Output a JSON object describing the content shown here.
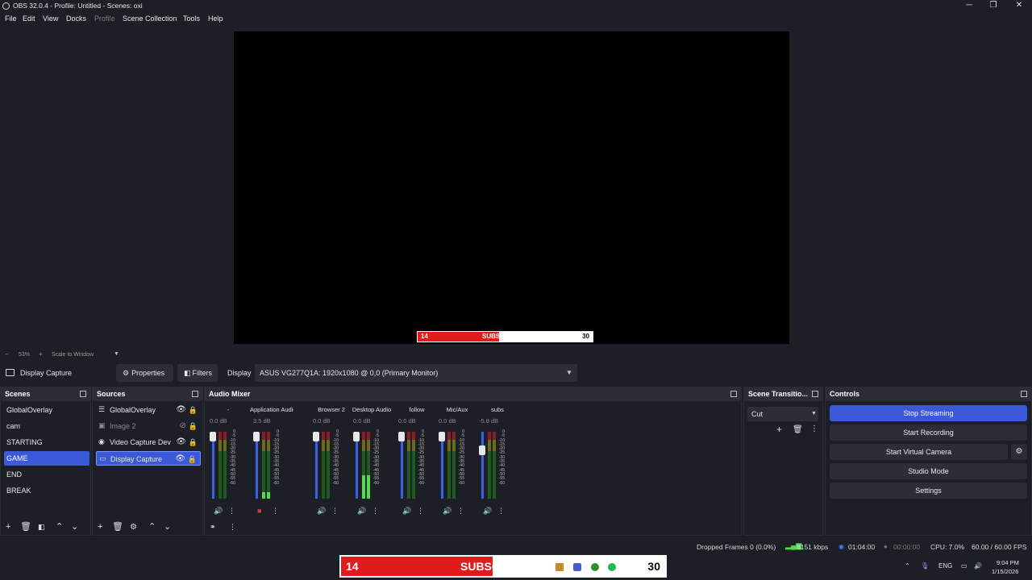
{
  "window": {
    "title": "OBS 32.0.4 - Profile: Untitled - Scenes: oxi",
    "controls": {
      "minimize": "─",
      "maximize": "❐",
      "close": "✕"
    }
  },
  "menu": [
    "File",
    "Edit",
    "View",
    "Docks",
    "Profile",
    "Scene Collection",
    "Tools",
    "Help"
  ],
  "preview": {
    "overlay": {
      "left_number": "14",
      "label": "SUBSCRIBERS",
      "right_number": "30",
      "progress": 0.467
    },
    "zoom_minus": "−",
    "zoom_value": "53%",
    "zoom_plus": "+",
    "scale_mode": "Scale to Window"
  },
  "source_toolbar": {
    "source_name": "Display Capture",
    "properties_label": "Properties",
    "filters_label": "Filters",
    "display_label": "Display",
    "display_value": "ASUS VG277Q1A: 1920x1080 @ 0,0 (Primary Monitor)"
  },
  "scenes": {
    "title": "Scenes",
    "items": [
      "GlobalOverlay",
      "cam",
      "STARTING",
      "GAME",
      "END",
      "BREAK"
    ],
    "active": "GAME"
  },
  "sources": {
    "title": "Sources",
    "items": [
      {
        "name": "GlobalOverlay",
        "icon": "list-icon",
        "visible": true
      },
      {
        "name": "Image 2",
        "icon": "image-icon",
        "visible": false
      },
      {
        "name": "Video Capture Dev",
        "icon": "camera-icon",
        "visible": true
      },
      {
        "name": "Display Capture",
        "icon": "monitor-icon",
        "visible": true
      }
    ],
    "active": "Display Capture"
  },
  "audio_mixer": {
    "title": "Audio Mixer",
    "scale": [
      "0",
      "-5",
      "-10",
      "-15",
      "-20",
      "-25",
      "-30",
      "-35",
      "-40",
      "-45",
      "-50",
      "-55",
      "-60"
    ],
    "channels": [
      {
        "name": "-",
        "db": "0.0 dB",
        "level": 0.0,
        "fader": 1.0,
        "muted": false
      },
      {
        "name": "Application Audio C",
        "db": "3.5 dB",
        "level": 0.1,
        "fader": 1.0,
        "muted": true
      },
      {
        "name": "Browser 2",
        "db": "0.0 dB",
        "level": 0.0,
        "fader": 1.0,
        "muted": false
      },
      {
        "name": "Desktop Audio",
        "db": "0.0 dB",
        "level": 0.35,
        "fader": 1.0,
        "muted": false
      },
      {
        "name": "follow",
        "db": "0.0 dB",
        "level": 0.0,
        "fader": 1.0,
        "muted": false
      },
      {
        "name": "Mic/Aux",
        "db": "0.0 dB",
        "level": 0.0,
        "fader": 1.0,
        "muted": false
      },
      {
        "name": "subs",
        "db": "-5.8 dB",
        "level": 0.0,
        "fader": 0.78,
        "muted": false
      }
    ]
  },
  "transitions": {
    "title": "Scene Transitio...",
    "value": "Cut"
  },
  "controls": {
    "title": "Controls",
    "buttons": [
      "Stop Streaming",
      "Start Recording",
      "Start Virtual Camera",
      "Studio Mode",
      "Settings"
    ]
  },
  "status": {
    "dropped_frames": "Dropped Frames 0 (0.0%)",
    "bitrate": "8151 kbps",
    "stream_time": "01:04:00",
    "record_time": "00:00:00",
    "cpu": "CPU: 7.0%",
    "fps": "60.00 / 60.00 FPS"
  },
  "taskbar": {
    "overlay": {
      "left_number": "14",
      "label": "SUBSCRIBERS",
      "right_number": "30",
      "progress": 0.467
    },
    "lang": "ENG",
    "time": "9:04 PM",
    "date": "1/15/2026"
  }
}
